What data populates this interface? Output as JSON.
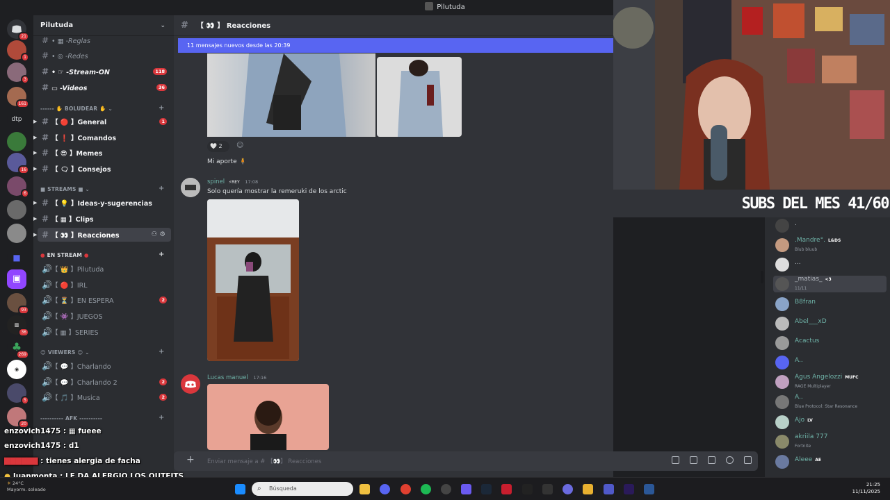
{
  "window": {
    "title": "Pilutuda"
  },
  "server_badges": [
    "21",
    "1",
    "3",
    "161",
    "dtp",
    "16",
    "6",
    "93",
    "36",
    "269",
    "5",
    "20"
  ],
  "server_header": {
    "name": "Pilutuda"
  },
  "channels": [
    {
      "label": "-Reglas",
      "icon": "note"
    },
    {
      "label": "-Redes",
      "icon": "globe"
    },
    {
      "label": "-Stream-ON",
      "count": "118"
    },
    {
      "label": "-Videos",
      "count": "36"
    }
  ],
  "categories": {
    "boludear": "BOLUDEAR",
    "streams": "STREAMS",
    "en_stream": "EN STREAM",
    "viewers": "VIEWERS",
    "afk": "AFK"
  },
  "boludear_channels": [
    {
      "label": "General",
      "count": "1"
    },
    {
      "label": "Comandos"
    },
    {
      "label": "Memes"
    },
    {
      "label": "Consejos"
    }
  ],
  "streams_channels": [
    {
      "label": "Ideas-y-sugerencias"
    },
    {
      "label": "Clips"
    },
    {
      "label": "Reacciones"
    }
  ],
  "voice_channels": [
    {
      "label": "Pilutuda"
    },
    {
      "label": "IRL"
    },
    {
      "label": "EN ESPERA",
      "count": "2"
    },
    {
      "label": "JUEGOS"
    },
    {
      "label": "SERIES"
    }
  ],
  "viewer_channels": [
    {
      "label": "Charlando"
    },
    {
      "label": "Charlando 2",
      "count": "2"
    },
    {
      "label": "Musica",
      "count": "2"
    }
  ],
  "main": {
    "channel_title": "Reacciones",
    "new_messages_bar": "11 mensajes nuevos desde las 20:39",
    "reaction_count": "2",
    "msg1_text": "Mi aporte 🧍",
    "msg2_user": "spinel",
    "msg2_tag": "REY",
    "msg2_time": "17:08",
    "msg2_text": "Solo quería mostrar la remeruki de los arctic",
    "msg3_user": "Lucas manuel",
    "msg3_time": "17:16",
    "composer_placeholder": "Enviar mensaje a #",
    "composer_channel": "Reacciones"
  },
  "stream_overlay": {
    "subs": "SUBS DEL MES 41/60"
  },
  "members": [
    {
      "name": ".",
      "color": "#b5bac1"
    },
    {
      "name": ".Mandre°.",
      "tag": "L&DS",
      "sub": "Blub bluub",
      "color": "#6fb3a8"
    },
    {
      "name": "...",
      "color": "#b5bac1"
    },
    {
      "name": "_matias_",
      "tag": "<3",
      "sub": "11/11",
      "color": "#b5bac1"
    },
    {
      "name": "B8fran",
      "color": "#6fb3a8"
    },
    {
      "name": "Abel___xD",
      "color": "#6fb3a8"
    },
    {
      "name": "Acactus",
      "color": "#6fb3a8"
    },
    {
      "name": "A..",
      "color": "#6fb3a8"
    },
    {
      "name": "Agus Angelozzi",
      "tag": "MUFC",
      "sub": "RAGE Multiplayer",
      "color": "#6fb3a8"
    },
    {
      "name": "A..",
      "sub": "Blue Protocol: Star Resonance",
      "color": "#6fb3a8"
    },
    {
      "name": "Ajo",
      "tag": "LV",
      "color": "#6fb3a8"
    },
    {
      "name": "akriila 777",
      "sub": "Fortnite",
      "color": "#6fb3a8"
    },
    {
      "name": "Aleee",
      "tag": "AE",
      "color": "#6fb3a8"
    }
  ],
  "stream_chat": [
    {
      "user": "enzovich1475",
      "text": "fueee"
    },
    {
      "user": "enzovich1475",
      "text": "d1"
    },
    {
      "user": "",
      "text": "tienes alergia de facha"
    },
    {
      "user": "Juanmonta",
      "text": "LE DA ALERGIO LOS OUTFITS"
    }
  ],
  "taskbar": {
    "search_placeholder": "Búsqueda",
    "time": "21:25",
    "date": "11/11/2025",
    "weather_temp": "24°C",
    "weather_desc": "Mayorm. soleado"
  }
}
